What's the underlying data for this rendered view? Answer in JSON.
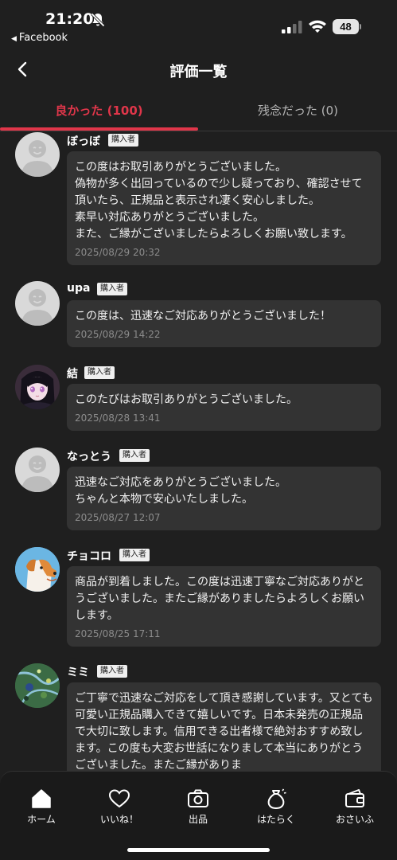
{
  "status_bar": {
    "time": "21:20",
    "back_app": "Facebook",
    "battery": "48"
  },
  "nav": {
    "title": "評価一覧"
  },
  "tabs": [
    {
      "label": "良かった (100)"
    },
    {
      "label": "残念だった (0)"
    }
  ],
  "reviews": [
    {
      "name": "ぼっぼ",
      "badge": "購入者",
      "avatar": "default",
      "text": "この度はお取引ありがとうございました。\n偽物が多く出回っているので少し疑っており、確認させて頂いたら、正規品と表示され凄く安心しました。\n素早い対応ありがとうございました。\nまた、ご縁がございましたらよろしくお願い致します。",
      "date": "2025/08/29 20:32"
    },
    {
      "name": "upa",
      "badge": "購入者",
      "avatar": "default",
      "text": "この度は、迅速なご対応ありがとうございました！",
      "date": "2025/08/29 14:22"
    },
    {
      "name": "結",
      "badge": "購入者",
      "avatar": "anime-girl",
      "text": "このたびはお取引ありがとうございました。",
      "date": "2025/08/28 13:41"
    },
    {
      "name": "なっとう",
      "badge": "購入者",
      "avatar": "default",
      "text": "迅速なご対応をありがとうございました。\nちゃんと本物で安心いたしました。",
      "date": "2025/08/27 12:07"
    },
    {
      "name": "チョコロ",
      "badge": "購入者",
      "avatar": "dog",
      "text": "商品が到着しました。この度は迅速丁寧なご対応ありがとうございました。またご縁がありましたらよろしくお願いします。",
      "date": "2025/08/25 17:11"
    },
    {
      "name": "ミミ",
      "badge": "購入者",
      "avatar": "map",
      "text": "ご丁寧で迅速なご対応をして頂き感謝しています。又とても可愛い正規品購入できて嬉しいです。日本未発売の正規品で大切に致します。信用できる出者様で絶対おすすめ致します。この度も大変お世話になりまして本当にありがとうございました。またご縁がありま",
      "date": ""
    }
  ],
  "tab_bar": [
    {
      "label": "ホーム",
      "icon": "home-icon"
    },
    {
      "label": "いいね！",
      "icon": "heart-icon"
    },
    {
      "label": "出品",
      "icon": "camera-icon"
    },
    {
      "label": "はたらく",
      "icon": "money-bag-icon"
    },
    {
      "label": "おさいふ",
      "icon": "wallet-icon"
    }
  ]
}
